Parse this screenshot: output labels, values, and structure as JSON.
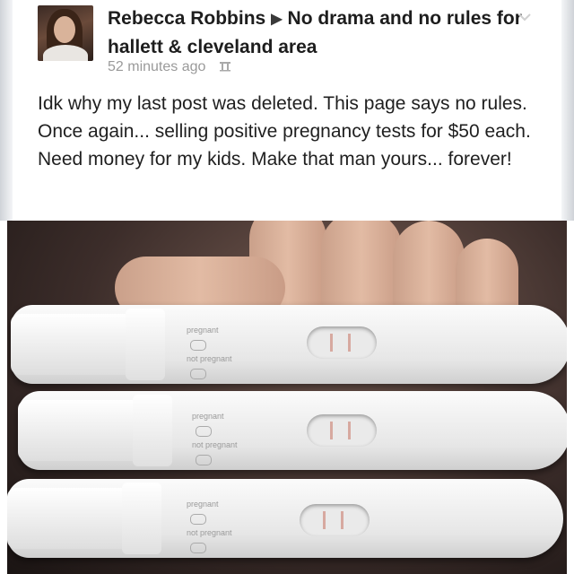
{
  "post": {
    "author": "Rebecca Robbins",
    "group": "No drama and no rules for hallett & cleveland area",
    "timestamp": "52 minutes ago",
    "text": "Idk why my last post was deleted. This page says no rules. Once again... selling positive pregnancy tests for $50 each. Need money for my kids. Make that man yours... forever!",
    "icons": {
      "arrow": "triangle-right-icon",
      "audience": "audience-icon",
      "menu": "chevron-down-icon"
    }
  },
  "photo": {
    "tests": [
      {
        "label_pregnant": "pregnant",
        "label_not_pregnant": "not pregnant"
      },
      {
        "label_pregnant": "pregnant",
        "label_not_pregnant": "not pregnant"
      },
      {
        "label_pregnant": "pregnant",
        "label_not_pregnant": "not pregnant"
      }
    ]
  }
}
